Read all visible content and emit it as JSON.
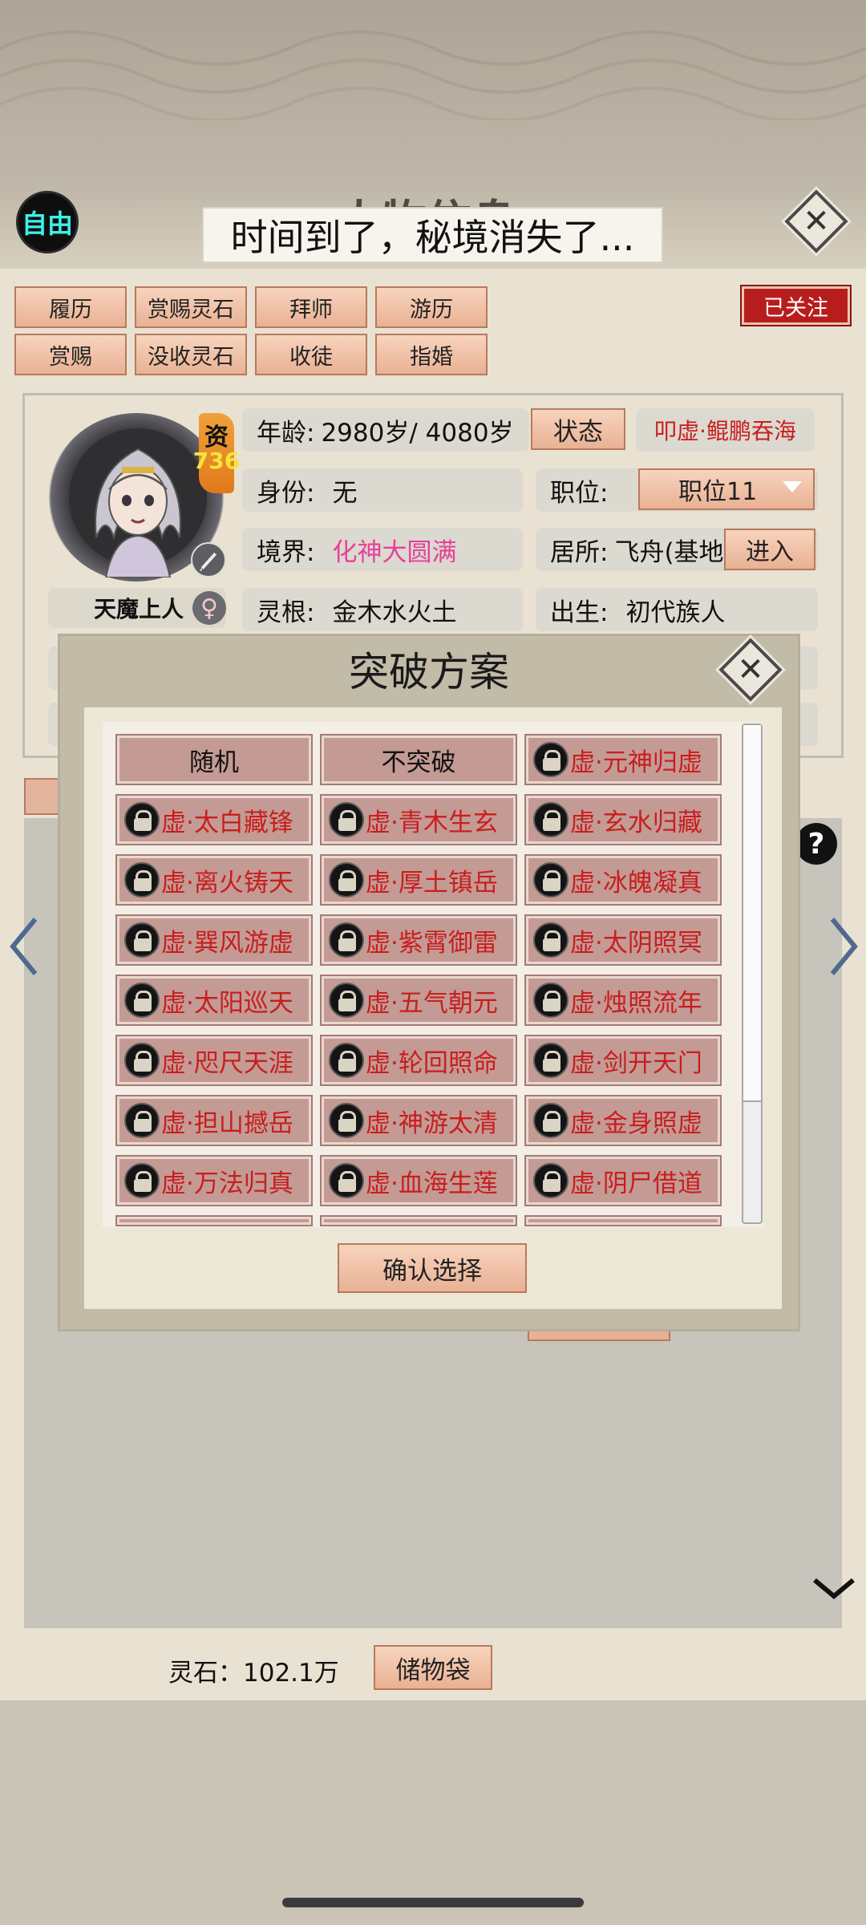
{
  "header": {
    "free_badge": "自由",
    "title_ghost": "人物信息",
    "toast": "时间到了，秘境消失了...",
    "followed_label": "已关注"
  },
  "actions": [
    {
      "label": "履历"
    },
    {
      "label": "赏赐灵石"
    },
    {
      "label": "拜师"
    },
    {
      "label": "游历"
    },
    {
      "label": "赏赐"
    },
    {
      "label": "没收灵石"
    },
    {
      "label": "收徒"
    },
    {
      "label": "指婚"
    }
  ],
  "character": {
    "aptitude_label": "资",
    "aptitude_value": "736",
    "title": "天魔上人",
    "gender_icon": "♀",
    "age_label": "年龄:",
    "age_value": "2980岁/ 4080岁",
    "status_button": "状态",
    "bow_tag": "叩虚·鲲鹏吞海",
    "identity_label": "身份:",
    "identity_value": "无",
    "position_label": "职位:",
    "position_value": "职位11",
    "realm_label": "境界:",
    "realm_value": "化神大圆满",
    "residence_label": "居所:",
    "residence_value": "飞舟(基地",
    "enter_button": "进入",
    "root_label": "灵根:",
    "root_value": "金木水火土",
    "birth_label": "出生:",
    "birth_value": "初代族人"
  },
  "help_icon": "?",
  "bottom": {
    "spirit_stone": "灵石：102.1万",
    "bag_button": "储物袋"
  },
  "modal": {
    "title": "突破方案",
    "confirm_button": "确认选择",
    "options": [
      {
        "label": "随机",
        "locked": false
      },
      {
        "label": "不突破",
        "locked": false
      },
      {
        "label": "虚·元神归虚",
        "locked": true
      },
      {
        "label": "虚·太白藏锋",
        "locked": true
      },
      {
        "label": "虚·青木生玄",
        "locked": true
      },
      {
        "label": "虚·玄水归藏",
        "locked": true
      },
      {
        "label": "虚·离火铸天",
        "locked": true
      },
      {
        "label": "虚·厚土镇岳",
        "locked": true
      },
      {
        "label": "虚·冰魄凝真",
        "locked": true
      },
      {
        "label": "虚·巽风游虚",
        "locked": true
      },
      {
        "label": "虚·紫霄御雷",
        "locked": true
      },
      {
        "label": "虚·太阴照冥",
        "locked": true
      },
      {
        "label": "虚·太阳巡天",
        "locked": true
      },
      {
        "label": "虚·五气朝元",
        "locked": true
      },
      {
        "label": "虚·烛照流年",
        "locked": true
      },
      {
        "label": "虚·咫尺天涯",
        "locked": true
      },
      {
        "label": "虚·轮回照命",
        "locked": true
      },
      {
        "label": "虚·剑开天门",
        "locked": true
      },
      {
        "label": "虚·担山撼岳",
        "locked": true
      },
      {
        "label": "虚·神游太清",
        "locked": true
      },
      {
        "label": "虚·金身照虚",
        "locked": true
      },
      {
        "label": "虚·万法归真",
        "locked": true
      },
      {
        "label": "虚·血海生莲",
        "locked": true
      },
      {
        "label": "虚·阴尸借道",
        "locked": true
      }
    ]
  },
  "colors": {
    "accent_red": "#c81e1e",
    "realm_pink": "#e8409a",
    "button_peach": "#e9b194",
    "option_bg": "#c49a94"
  }
}
